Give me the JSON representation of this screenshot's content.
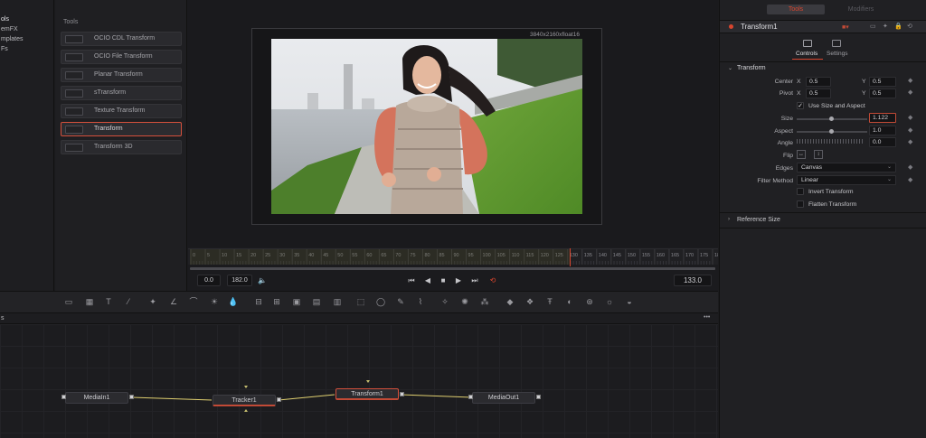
{
  "categories": [
    "ols",
    "emFX",
    "mplates",
    "Fs"
  ],
  "tools_panel": {
    "title": "Tools",
    "items": [
      {
        "label": "OCIO CDL Transform",
        "icon": "ocio-cdl-icon"
      },
      {
        "label": "OCIO File Transform",
        "icon": "ocio-file-icon"
      },
      {
        "label": "Planar Transform",
        "icon": "planar-icon"
      },
      {
        "label": "sTransform",
        "icon": "stransform-icon"
      },
      {
        "label": "Texture Transform",
        "icon": "texture-icon"
      },
      {
        "label": "Transform",
        "icon": "transform-icon"
      },
      {
        "label": "Transform 3D",
        "icon": "transform3d-icon"
      }
    ]
  },
  "viewer": {
    "resolution": "3840x2160xfloat16",
    "image_alt": "woman jogging along riverside path"
  },
  "ruler": {
    "ticks": [
      "0",
      "5",
      "10",
      "15",
      "20",
      "25",
      "30",
      "35",
      "40",
      "45",
      "50",
      "55",
      "60",
      "65",
      "70",
      "75",
      "80",
      "85",
      "90",
      "95",
      "100",
      "105",
      "110",
      "115",
      "120",
      "125",
      "130",
      "135",
      "140",
      "145",
      "150",
      "155",
      "160",
      "165",
      "170",
      "175",
      "180"
    ]
  },
  "transport": {
    "start": "0.0",
    "end": "182.0",
    "current": "133.0"
  },
  "nodes": {
    "mediain": "MediaIn1",
    "tracker": "Tracker1",
    "transform": "Transform1",
    "mediaout": "MediaOut1"
  },
  "node_header": {
    "title": "s",
    "menu": "•••"
  },
  "inspector": {
    "tabs": [
      "Tools",
      "Modifiers"
    ],
    "node_name": "Transform1",
    "subtabs": [
      "Controls",
      "Settings"
    ],
    "section": "Transform",
    "center": {
      "label": "Center",
      "x_label": "X",
      "x": "0.5",
      "y_label": "Y",
      "y": "0.5"
    },
    "pivot": {
      "label": "Pivot",
      "x_label": "X",
      "x": "0.5",
      "y_label": "Y",
      "y": "0.5"
    },
    "use_size_aspect": "Use Size and Aspect",
    "size": {
      "label": "Size",
      "value": "1.122"
    },
    "aspect": {
      "label": "Aspect",
      "value": "1.0"
    },
    "angle": {
      "label": "Angle",
      "value": "0.0"
    },
    "flip": {
      "label": "Flip"
    },
    "edges": {
      "label": "Edges",
      "value": "Canvas"
    },
    "filter_method": {
      "label": "Filter Method",
      "value": "Linear"
    },
    "invert": "Invert Transform",
    "flatten": "Flatten Transform",
    "reference_size": "Reference Size"
  },
  "colors": {
    "accent_red": "#d4503c",
    "selection": "#c24a36"
  }
}
